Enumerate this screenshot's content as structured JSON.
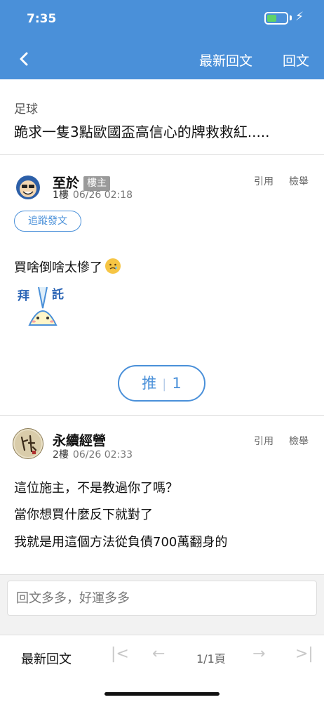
{
  "status": {
    "time": "7:35",
    "battery_level": 0.5
  },
  "nav": {
    "latest_reply": "最新回文",
    "reply": "回文"
  },
  "topic": {
    "board": "足球",
    "title": "跪求一隻3點歐國盃高信心的牌救救紅....."
  },
  "posts": [
    {
      "author": "至於",
      "badge": "樓主",
      "floor": "1樓",
      "time": "06/26 02:18",
      "quote_label": "引用",
      "report_label": "檢舉",
      "follow_label": "追蹤發文",
      "body": "買啥倒啥太慘了",
      "sticker_text": "拜託",
      "push_label": "推",
      "push_count": "1"
    },
    {
      "author": "永續經營",
      "floor": "2樓",
      "time": "06/26 02:33",
      "quote_label": "引用",
      "report_label": "檢舉",
      "body_lines": [
        "這位施主，不是教過你了嗎？",
        "當你想買什麼反下就對了",
        "我就是用這個方法從負債700萬翻身的"
      ]
    }
  ],
  "reply_box": {
    "placeholder": "回文多多，好運多多"
  },
  "footer": {
    "latest": "最新回文",
    "first_icon": "|<",
    "prev_icon": "←",
    "page": "1/1頁",
    "next_icon": "→",
    "last_icon": ">|"
  },
  "colors": {
    "brand": "#4a90d9",
    "battery": "#5fd36a"
  }
}
